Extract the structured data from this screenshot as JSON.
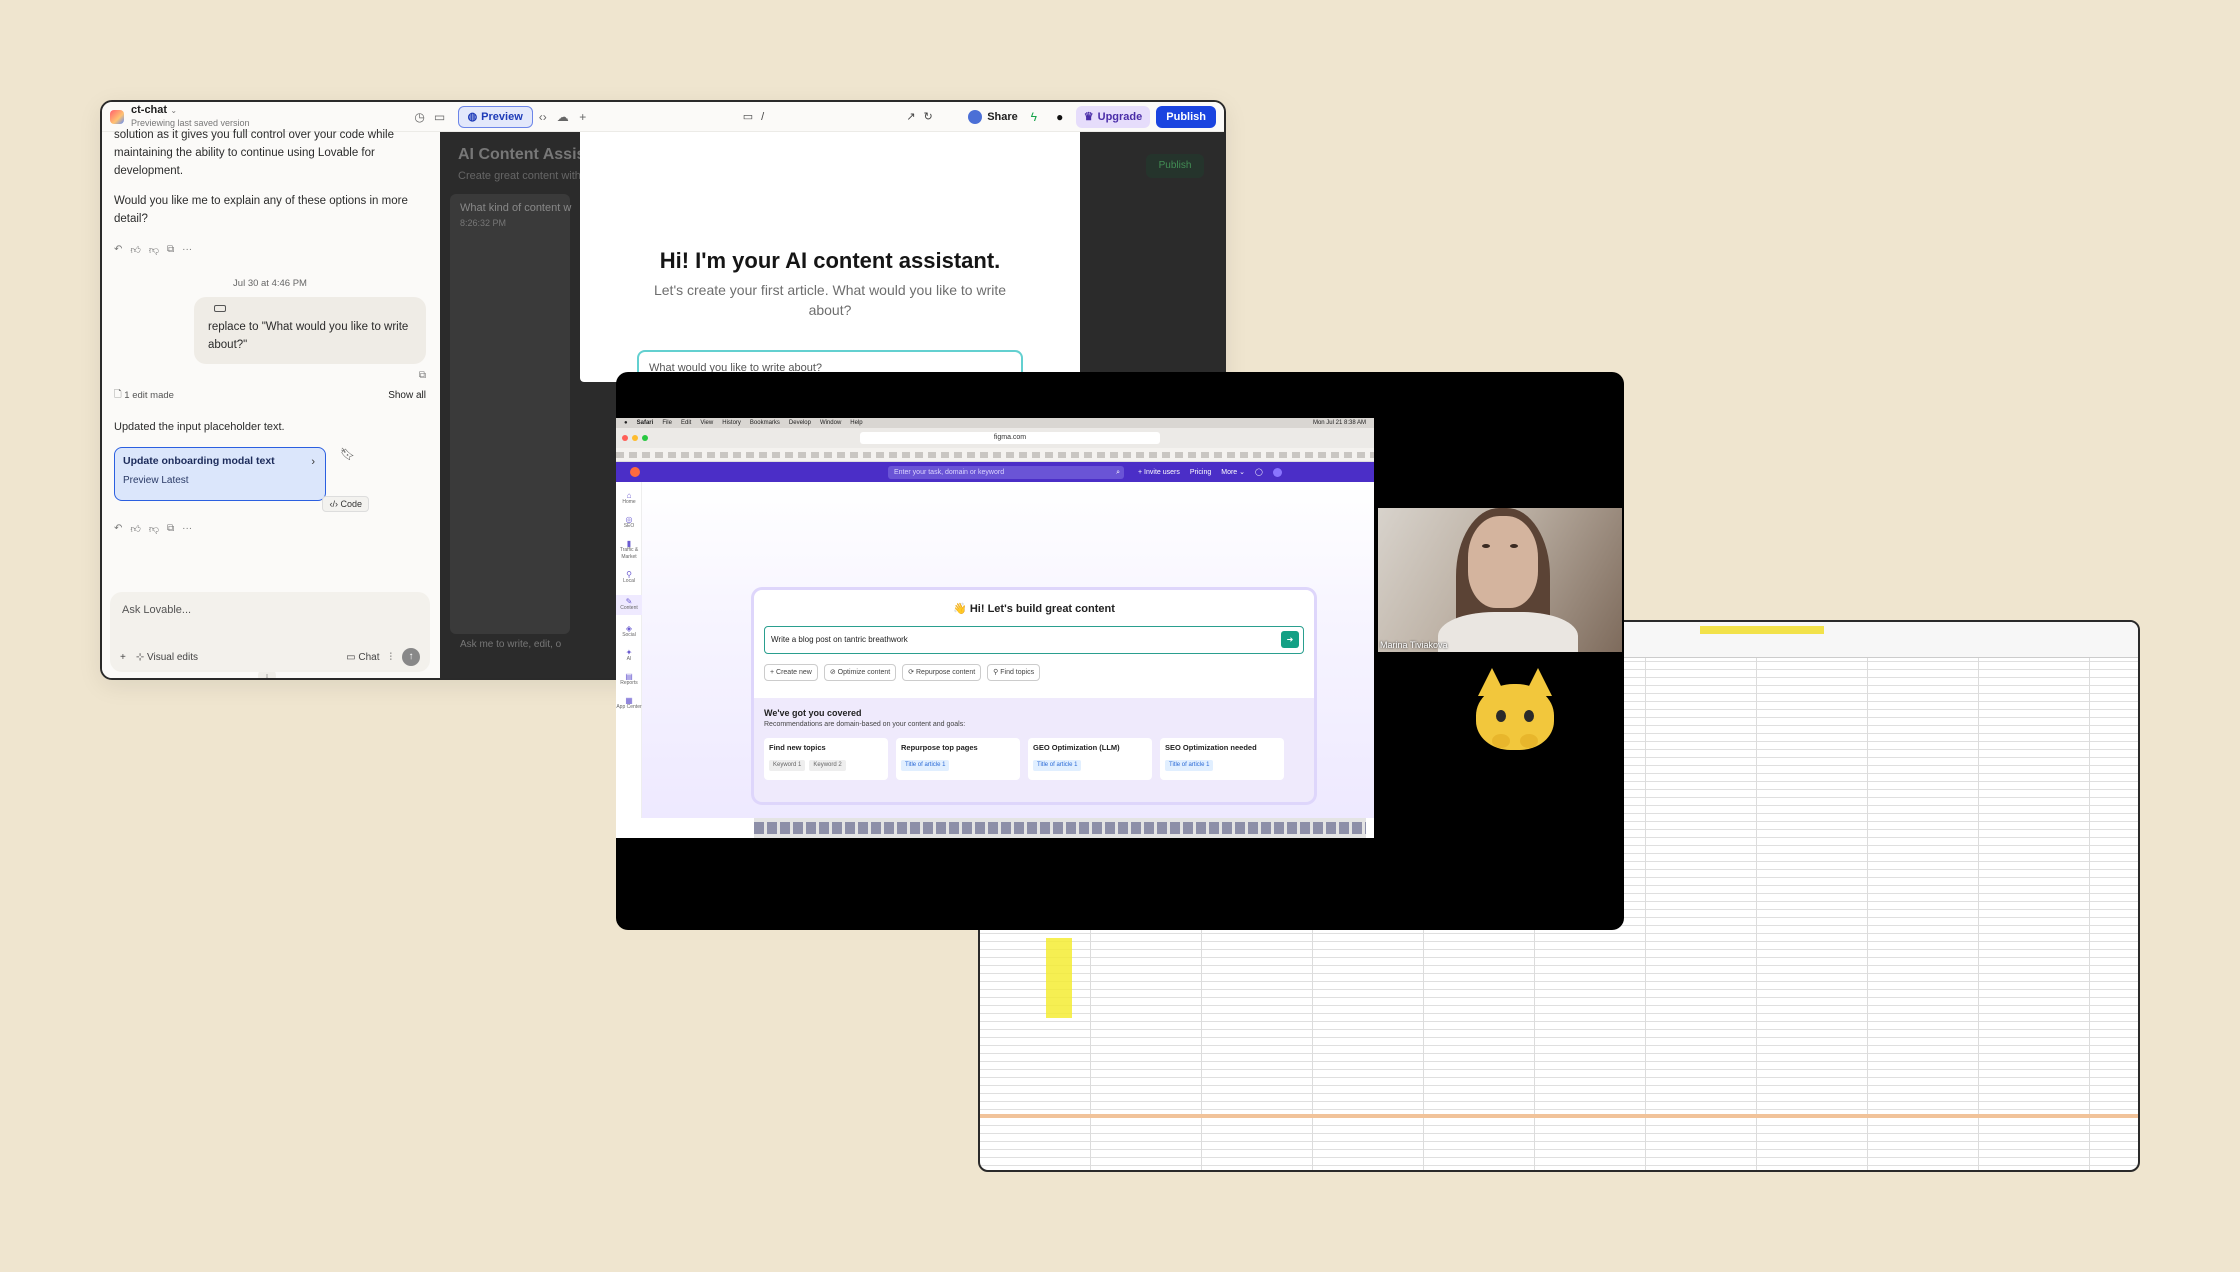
{
  "lovable": {
    "project_name": "ct-chat",
    "project_status": "Previewing last saved version",
    "preview_label": "Preview",
    "address": "/",
    "share_label": "Share",
    "upgrade_label": "Upgrade",
    "publish_label": "Publish",
    "chat": {
      "assistant_partial_1": "solution as it gives you full control over your code while maintaining the ability to continue using Lovable for development.",
      "assistant_partial_2": "Would you like me to explain any of these options in more detail?",
      "date": "Jul 30 at 4:46 PM",
      "user_message": "replace to \"What would you like to write about?\"",
      "edits_made": "1 edit made",
      "show_all": "Show all",
      "updated_text": "Updated the input placeholder text.",
      "card_title": "Update onboarding modal text",
      "card_preview": "Preview Latest",
      "code_tag": "Code",
      "composer_placeholder": "Ask Lovable...",
      "visual_edits": "Visual edits",
      "chat_label": "Chat"
    },
    "preview": {
      "bg_title": "AI Content Assist",
      "bg_subtitle": "Create great content with",
      "bg_question": "What kind of content w",
      "bg_time": "8:26:32 PM",
      "bg_publish": "Publish",
      "bg_ask": "Ask me to write, edit, o",
      "modal_title": "Hi! I'm your AI content assistant.",
      "modal_subtitle": "Let's create your first article. What would you like to write about?",
      "modal_input_placeholder": "What would you like to write about?"
    }
  },
  "call": {
    "mac_menu": [
      "Safari",
      "File",
      "Edit",
      "View",
      "History",
      "Bookmarks",
      "Develop",
      "Window",
      "Help"
    ],
    "clock": "Mon Jul 21  8:38 AM",
    "url": "figma.com",
    "search_placeholder": "Enter your task, domain or keyword",
    "top_menu": [
      "Invite users",
      "Pricing",
      "More"
    ],
    "sidebar": [
      "Home",
      "SEO",
      "Traffic & Market",
      "Local",
      "Content",
      "Social",
      "AI",
      "Reports",
      "App Center"
    ],
    "hero_title": "👋 Hi! Let's build great content",
    "hero_input": "Write a blog post on tantric breathwork",
    "chips": [
      "+ Create new",
      "Optimize content",
      "Repurpose content",
      "Find topics"
    ],
    "rec_title": "We've got you covered",
    "rec_sub": "Recommendations are domain-based on your content and goals:",
    "rec_cards": [
      {
        "title": "Find new topics",
        "tag1": "Keyword 1",
        "tag2": "Keyword 2"
      },
      {
        "title": "Repurpose top pages",
        "tag1": "Title of article 1"
      },
      {
        "title": "GEO Optimization (LLM)",
        "tag1": "Title of article 1"
      },
      {
        "title": "SEO Optimization needed",
        "tag1": "Title of article 1"
      }
    ],
    "participant_name": "Marina Tiviakova"
  }
}
